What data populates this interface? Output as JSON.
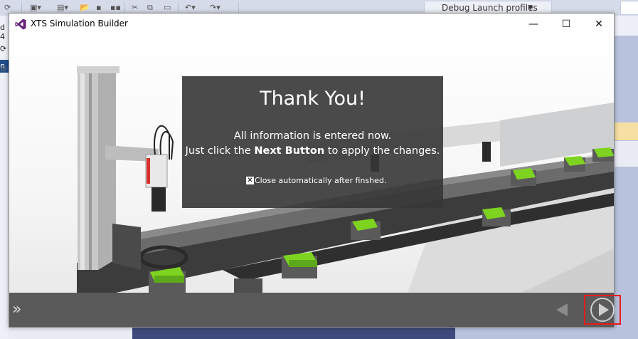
{
  "ide": {
    "toolbar_dropdown": "Debug Launch profiles",
    "left_labels": [
      "d 4",
      "n"
    ]
  },
  "window": {
    "title": "XTS Simulation Builder",
    "controls": {
      "minimize": "—",
      "maximize": "☐",
      "close": "✕"
    }
  },
  "dialog": {
    "heading": "Thank You!",
    "line1": "All information is entered now.",
    "line2_prefix": "Just click the ",
    "line2_bold": "Next Button",
    "line2_suffix": " to apply the changes.",
    "checkbox_label": "Close automatically after finshed.",
    "checkbox_checked": true
  },
  "footer": {
    "collapse_glyph": "»",
    "highlight_color": "#e51b1b"
  },
  "colors": {
    "overlay": "#363636",
    "footer": "#5a5a5a",
    "accent_green": "#7ed320",
    "vs_purple": "#68217a"
  }
}
